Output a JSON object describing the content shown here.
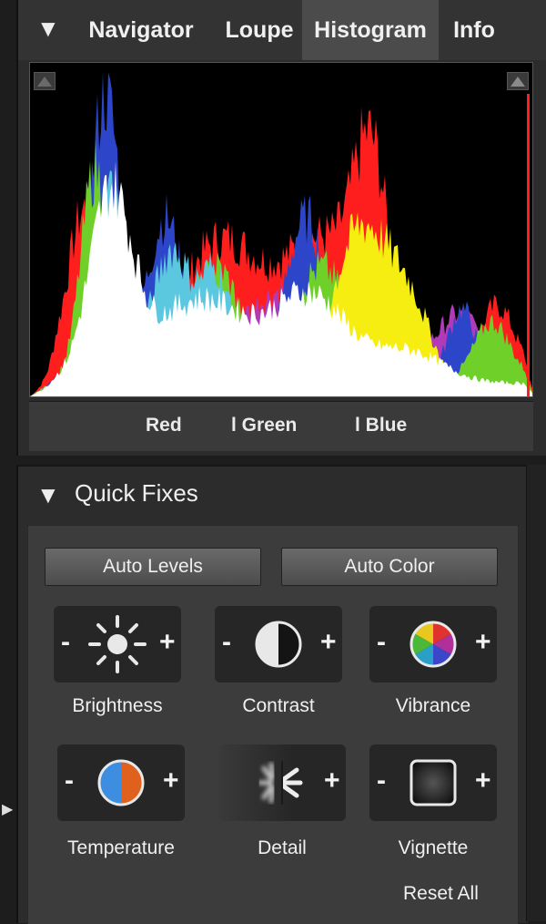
{
  "tabs": [
    {
      "label": "Navigator",
      "active": false
    },
    {
      "label": "Loupe",
      "active": false
    },
    {
      "label": "Histogram",
      "active": true
    },
    {
      "label": "Info",
      "active": false
    }
  ],
  "histogram": {
    "legend": [
      "Red",
      "l Green",
      "l Blue"
    ],
    "colors": {
      "red": "#ff1e1e",
      "green": "#6fd02a",
      "blue": "#2d45c8",
      "cyan": "#5cc8e0",
      "yellow": "#f5ee10",
      "magenta": "#b03ab8",
      "white": "#ffffff"
    }
  },
  "quick_fixes": {
    "title": "Quick Fixes",
    "auto_levels": "Auto Levels",
    "auto_color": "Auto Color",
    "minus": "-",
    "plus": "+",
    "tiles": [
      {
        "label": "Brightness",
        "icon": "sun-icon"
      },
      {
        "label": "Contrast",
        "icon": "contrast-icon"
      },
      {
        "label": "Vibrance",
        "icon": "color-wheel-icon"
      },
      {
        "label": "Temperature",
        "icon": "temperature-icon"
      },
      {
        "label": "Detail",
        "icon": "detail-icon"
      },
      {
        "label": "Vignette",
        "icon": "vignette-icon"
      }
    ],
    "reset_all": "Reset All"
  }
}
